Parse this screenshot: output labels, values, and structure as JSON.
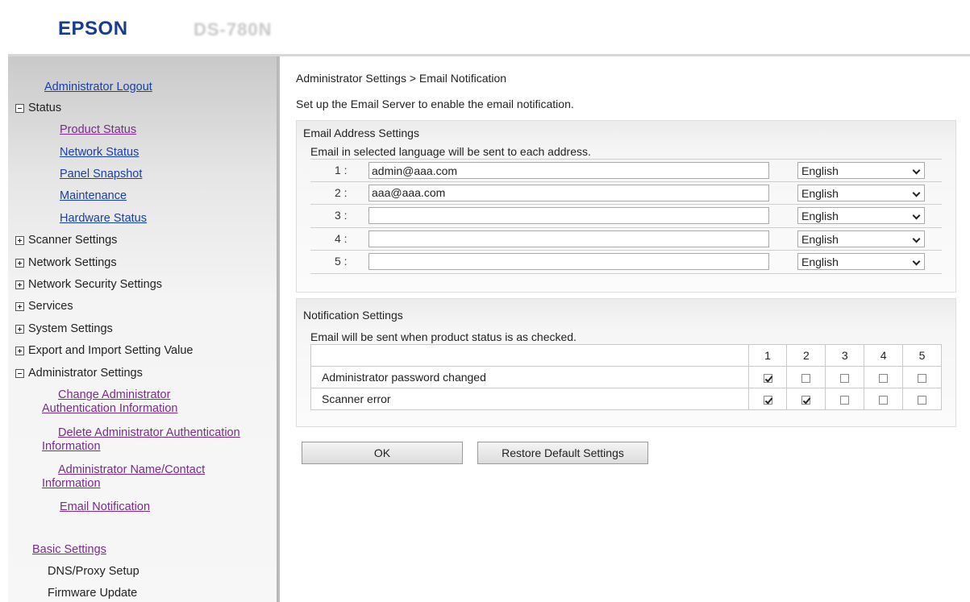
{
  "header": {
    "logo": "EPSON",
    "model": "DS-780N"
  },
  "sidebar": {
    "logout": "Administrator Logout",
    "status": {
      "label": "Status",
      "items": [
        "Product Status",
        "Network Status",
        "Panel Snapshot",
        "Maintenance",
        "Hardware Status"
      ]
    },
    "collapsed": [
      "Scanner Settings",
      "Network Settings",
      "Network Security Settings",
      "Services",
      "System Settings",
      "Export and Import Setting Value"
    ],
    "admin": {
      "label": "Administrator Settings",
      "items": [
        {
          "line1": "Change Administrator",
          "line2": "Authentication Information"
        },
        {
          "line1": "Delete Administrator Authentication",
          "line2": "Information"
        },
        {
          "line1": "Administrator Name/Contact",
          "line2": "Information"
        },
        {
          "line1": "Email Notification",
          "line2": ""
        }
      ]
    },
    "basic": {
      "label": "Basic Settings",
      "items": [
        "DNS/Proxy Setup",
        "Firmware Update"
      ]
    }
  },
  "main": {
    "breadcrumb": "Administrator Settings > Email Notification",
    "intro": "Set up the Email Server to enable the email notification.",
    "address_settings": {
      "title": "Email Address Settings",
      "description": "Email in selected language will be sent to each address.",
      "rows": [
        {
          "num": "1 :",
          "email": "admin@aaa.com",
          "lang": "English"
        },
        {
          "num": "2 :",
          "email": "aaa@aaa.com",
          "lang": "English"
        },
        {
          "num": "3 :",
          "email": "",
          "lang": "English"
        },
        {
          "num": "4 :",
          "email": "",
          "lang": "English"
        },
        {
          "num": "5 :",
          "email": "",
          "lang": "English"
        }
      ]
    },
    "notification_settings": {
      "title": "Notification Settings",
      "description": "Email will be sent when product status is as checked.",
      "columns": [
        "1",
        "2",
        "3",
        "4",
        "5"
      ],
      "rows": [
        {
          "label": "Administrator password changed",
          "checks": [
            true,
            false,
            false,
            false,
            false
          ]
        },
        {
          "label": "Scanner error",
          "checks": [
            true,
            true,
            false,
            false,
            false
          ]
        }
      ]
    },
    "buttons": {
      "ok": "OK",
      "restore": "Restore Default Settings"
    }
  }
}
